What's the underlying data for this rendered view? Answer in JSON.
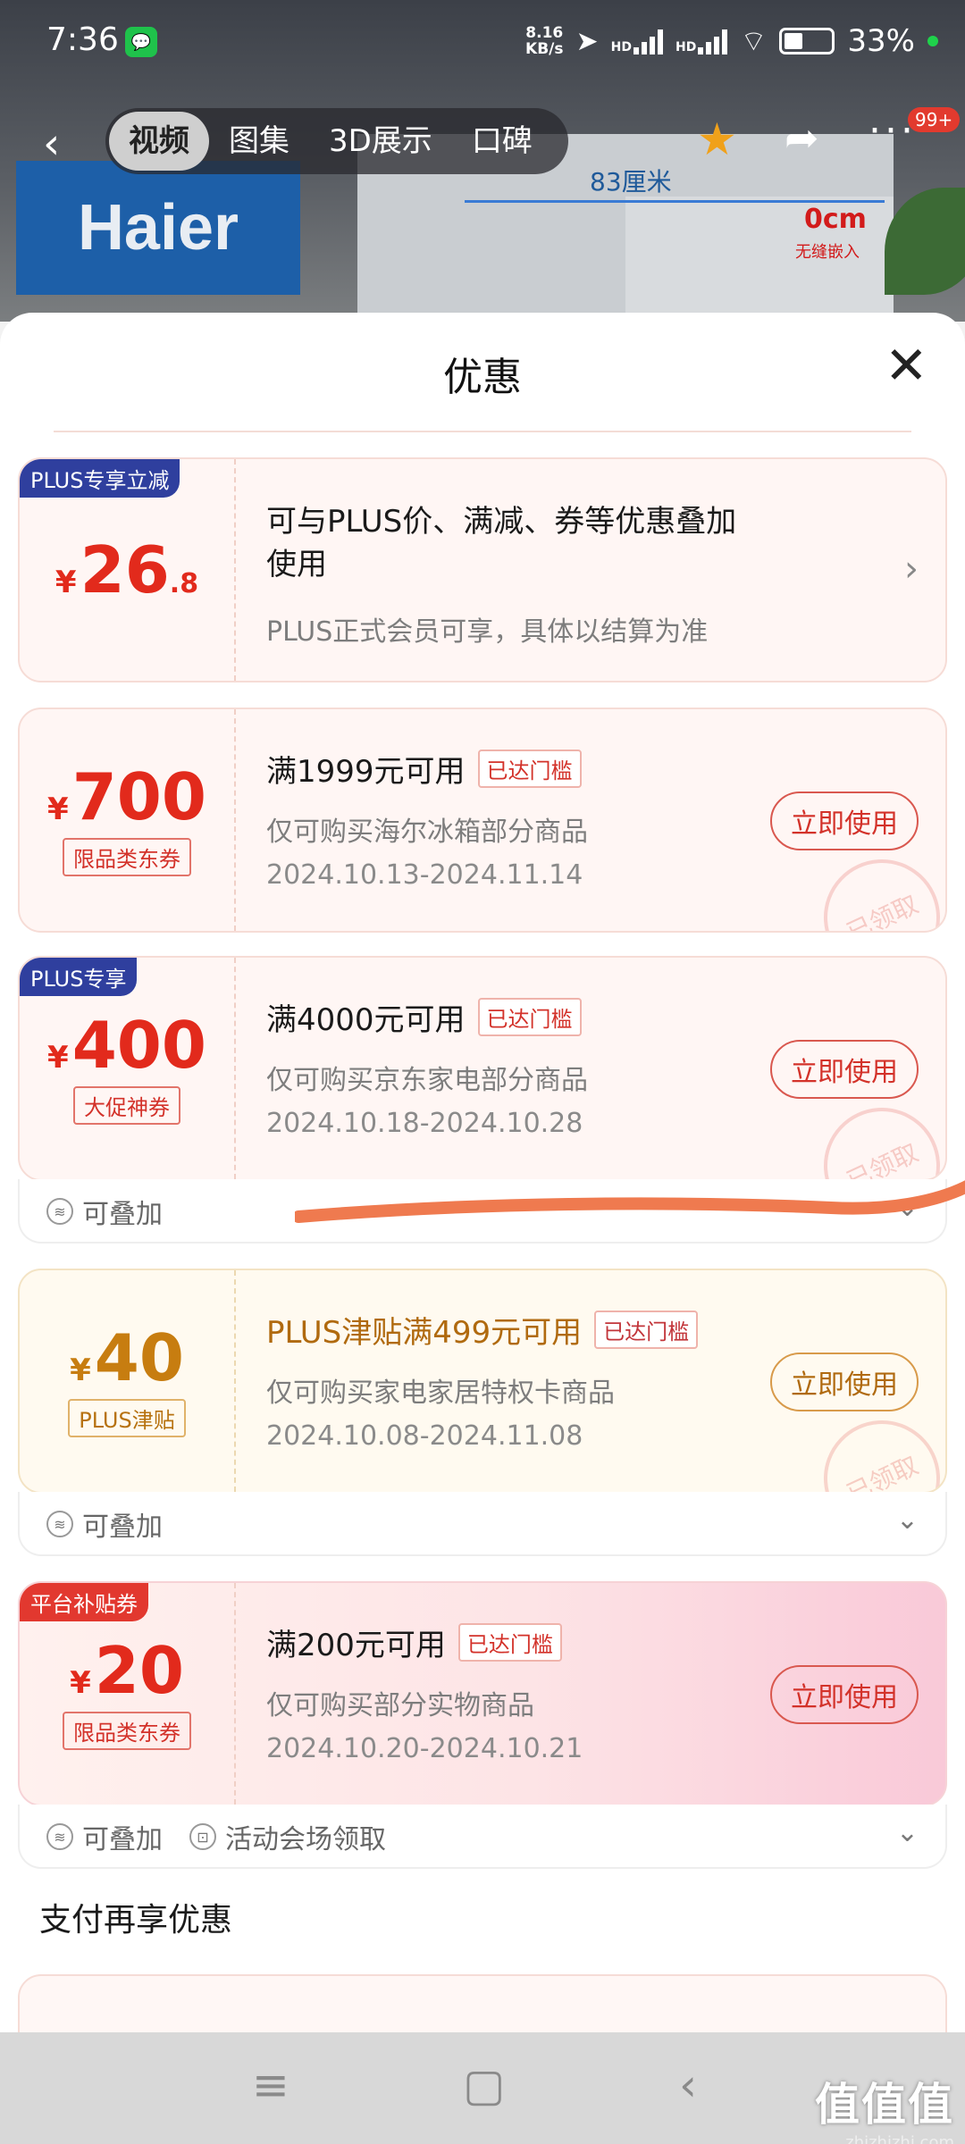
{
  "status_bar": {
    "time": "7:36",
    "net_speed_top": "8.16",
    "net_speed_bottom": "KB/s",
    "battery": "33%",
    "hd1": "HD",
    "hd2": "HD"
  },
  "nav": {
    "tabs": [
      {
        "label": "视频",
        "active": true
      },
      {
        "label": "图集"
      },
      {
        "label": "3D展示"
      },
      {
        "label": "口碑"
      }
    ],
    "badge": "99+"
  },
  "product_bg": {
    "brand": "Haier",
    "dimension": "83厘米",
    "gap": "0cm",
    "gap_note": "无缝嵌入"
  },
  "sheet": {
    "title": "优惠"
  },
  "plus_card": {
    "corner": "PLUS专享立减",
    "yen": "¥",
    "amount": "26",
    "decimal": ".8",
    "title_line1": "可与PLUS价、满减、券等优惠叠加",
    "title_line2": "使用",
    "sub": "PLUS正式会员可享，具体以结算为准"
  },
  "coupons": [
    {
      "yen": "¥",
      "amount": "700",
      "tag": "限品类东券",
      "title": "满1999元可用",
      "reach": "已达门槛",
      "sub": "仅可购买海尔冰箱部分商品",
      "date": "2024.10.13-2024.11.14",
      "button": "立即使用",
      "stamp": "已领取"
    },
    {
      "corner": "PLUS专享",
      "yen": "¥",
      "amount": "400",
      "tag": "大促神券",
      "title": "满4000元可用",
      "reach": "已达门槛",
      "sub": "仅可购买京东家电部分商品",
      "date": "2024.10.18-2024.10.28",
      "button": "立即使用",
      "stamp": "已领取",
      "foot": [
        "可叠加"
      ]
    },
    {
      "yen": "¥",
      "amount": "40",
      "tag": "PLUS津贴",
      "title": "PLUS津贴满499元可用",
      "reach": "已达门槛",
      "sub": "仅可购买家电家居特权卡商品",
      "date": "2024.10.08-2024.11.08",
      "button": "立即使用",
      "stamp": "已领取",
      "foot": [
        "可叠加"
      ]
    },
    {
      "corner": "平台补贴券",
      "yen": "¥",
      "amount": "20",
      "tag": "限品类东券",
      "title": "满200元可用",
      "reach": "已达门槛",
      "sub": "仅可购买部分实物商品",
      "date": "2024.10.20-2024.10.21",
      "button": "立即使用",
      "foot": [
        "可叠加",
        "活动会场领取"
      ]
    }
  ],
  "section_title": "支付再享优惠",
  "watermark": {
    "big": "值值值",
    "small": "zhizhizhi.com"
  },
  "colors": {
    "accent_red": "#e22a1c",
    "plus_blue": "#2f3f9e",
    "gold": "#c77d10",
    "annotation_stroke": "#ef7a4f"
  }
}
